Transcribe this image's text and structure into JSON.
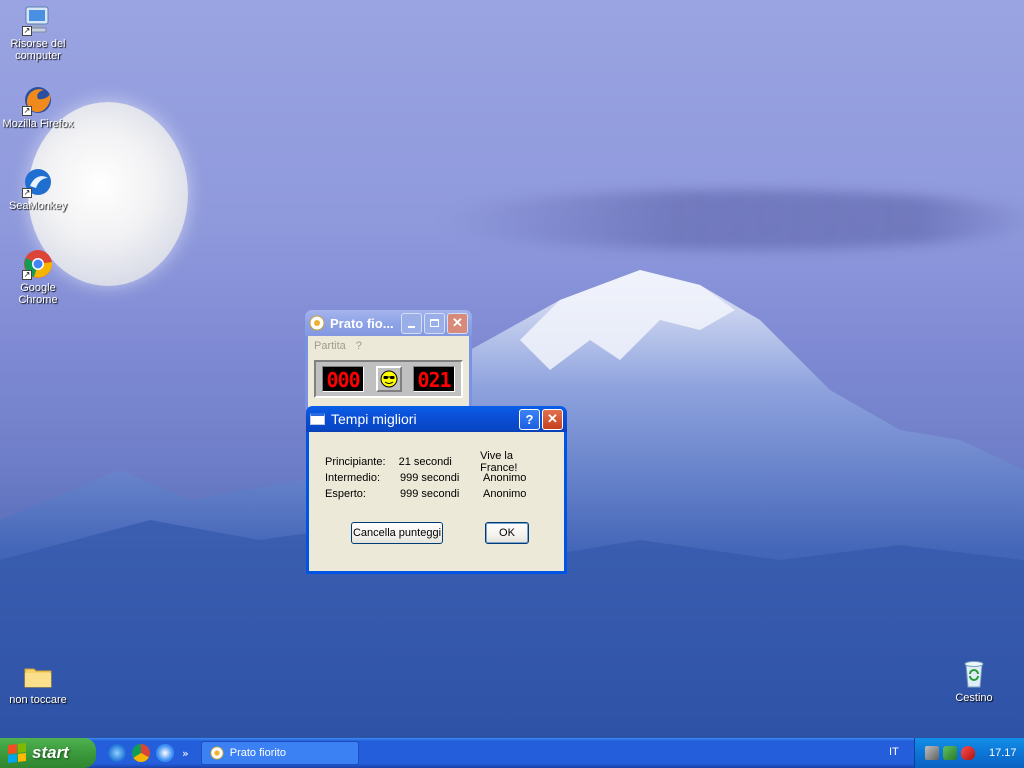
{
  "desktop": {
    "icons": [
      {
        "label": "Risorse del computer",
        "icon": "my-computer-icon"
      },
      {
        "label": "Mozilla Firefox",
        "icon": "firefox-icon"
      },
      {
        "label": "SeaMonkey",
        "icon": "seamonkey-icon"
      },
      {
        "label": "Google Chrome",
        "icon": "chrome-icon"
      },
      {
        "label": "non toccare",
        "icon": "folder-icon"
      },
      {
        "label": "Cestino",
        "icon": "recycle-bin-icon"
      }
    ]
  },
  "minesweeper": {
    "title": "Prato fio...",
    "menu": [
      "Partita",
      "?"
    ],
    "mines_counter": "000",
    "timer": "021"
  },
  "dialog": {
    "title": "Tempi migliori",
    "scores": [
      {
        "level": "Principiante:",
        "time": "21 secondi",
        "name": "Vive la France!"
      },
      {
        "level": "Intermedio:",
        "time": "999 secondi",
        "name": "Anonimo"
      },
      {
        "level": "Esperto:",
        "time": "999 secondi",
        "name": "Anonimo"
      }
    ],
    "reset_label": "Cancella punteggi",
    "ok_label": "OK",
    "help_label": "?",
    "close_label": "✕"
  },
  "taskbar": {
    "start_label": "start",
    "quick_more": "»",
    "task_label": "Prato fiorito",
    "language": "IT",
    "clock": "17.17"
  },
  "colors": {
    "titlebar_active": "#0a4fd6",
    "titlebar_inactive": "#8ea3e6",
    "taskbar": "#245edb",
    "start_green": "#3c9a3c"
  }
}
